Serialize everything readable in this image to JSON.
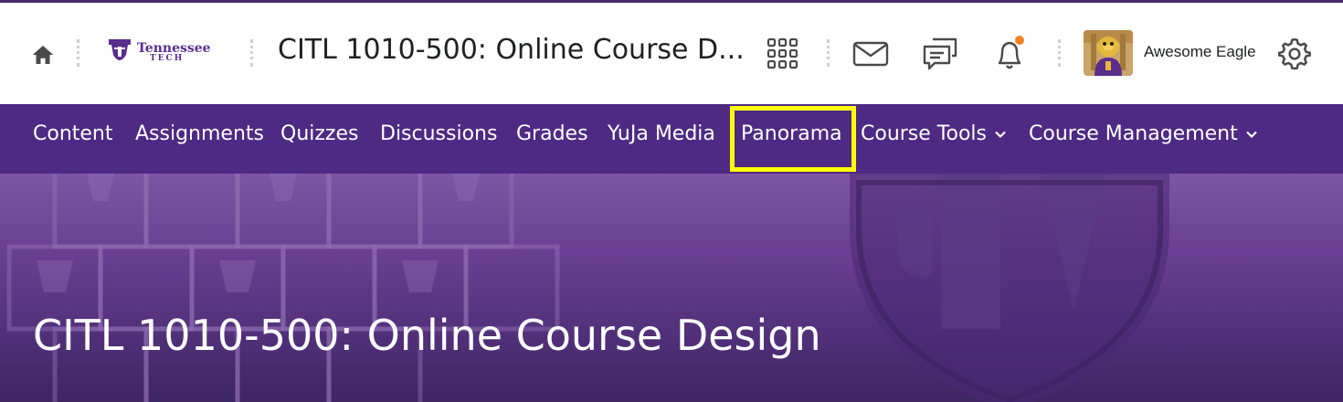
{
  "header": {
    "course_title": "CITL 1010-500: Online Course D...",
    "logo_line1": "Tennessee",
    "logo_line2": "TECH",
    "user_name": "Awesome Eagle",
    "notification_dot_color": "#f5821f",
    "icons": [
      "home-icon",
      "apps-grid-icon",
      "mail-icon",
      "chat-icon",
      "bell-icon",
      "gear-icon"
    ]
  },
  "nav": {
    "items": [
      {
        "label": "Content"
      },
      {
        "label": "Assignments"
      },
      {
        "label": "Quizzes"
      },
      {
        "label": "Discussions"
      },
      {
        "label": "Grades"
      },
      {
        "label": "YuJa Media"
      },
      {
        "label": "Panorama",
        "highlighted": true
      },
      {
        "label": "Course Tools",
        "dropdown": true
      },
      {
        "label": "Course Management",
        "dropdown": true
      }
    ],
    "background": "#4e2a84",
    "highlight_color": "#ffff00"
  },
  "banner": {
    "title": "CITL 1010-500: Online Course Design"
  }
}
